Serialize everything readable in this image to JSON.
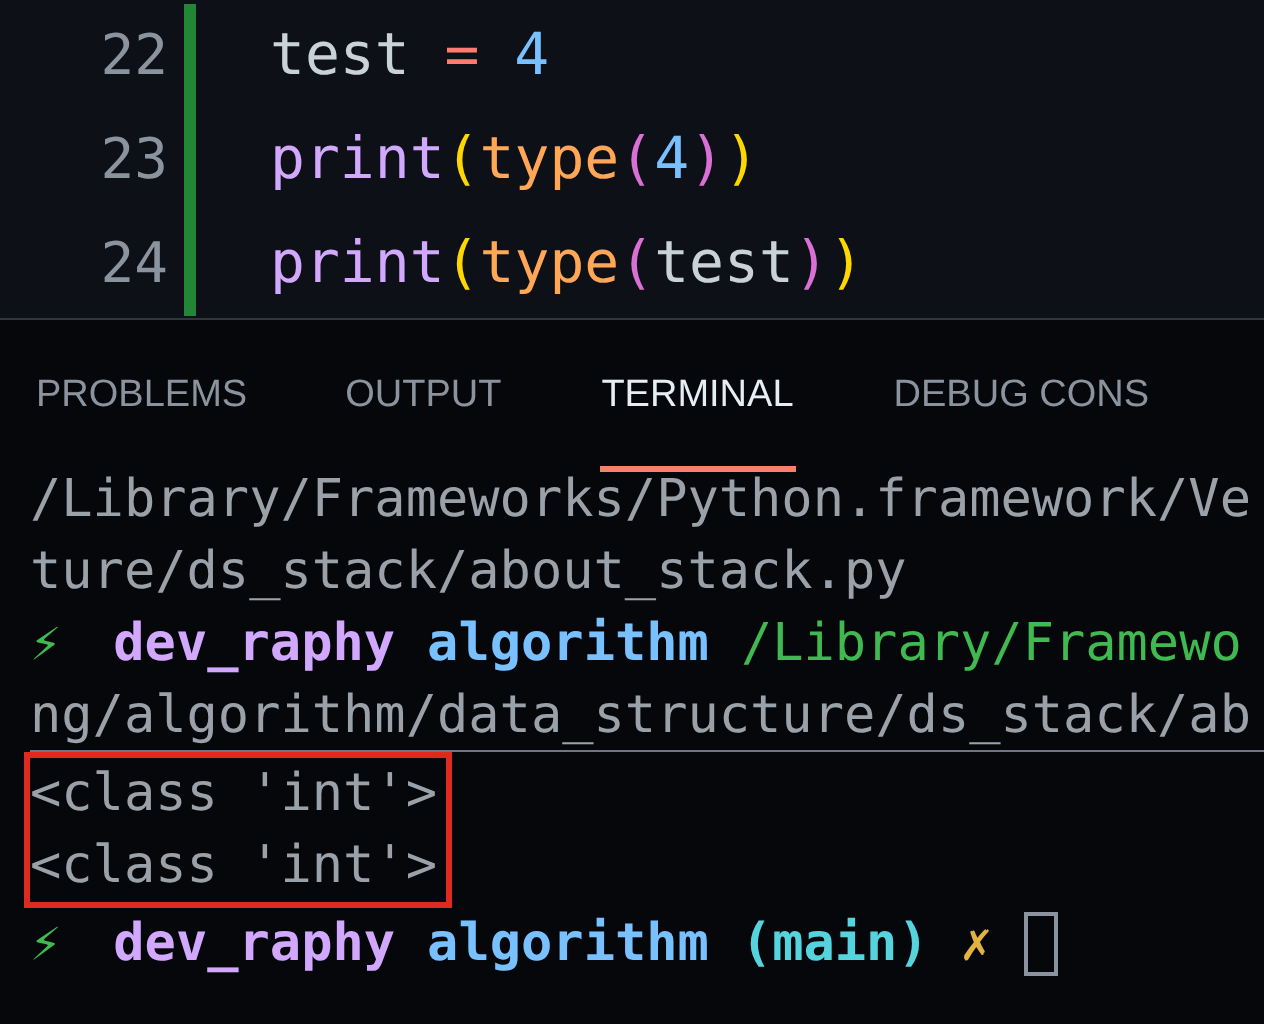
{
  "editor": {
    "lines": [
      {
        "number": "22",
        "tokens": [
          {
            "kind": "plain",
            "text": "test"
          },
          {
            "kind": "space"
          },
          {
            "kind": "op",
            "text": "="
          },
          {
            "kind": "space"
          },
          {
            "kind": "num",
            "text": "4"
          }
        ]
      },
      {
        "number": "23",
        "tokens": [
          {
            "kind": "builtin",
            "text": "print"
          },
          {
            "kind": "paren1",
            "text": "("
          },
          {
            "kind": "func",
            "text": "type"
          },
          {
            "kind": "paren2",
            "text": "("
          },
          {
            "kind": "num",
            "text": "4"
          },
          {
            "kind": "paren2",
            "text": ")"
          },
          {
            "kind": "paren1",
            "text": ")"
          }
        ]
      },
      {
        "number": "24",
        "tokens": [
          {
            "kind": "builtin",
            "text": "print"
          },
          {
            "kind": "paren1",
            "text": "("
          },
          {
            "kind": "func",
            "text": "type"
          },
          {
            "kind": "paren2",
            "text": "("
          },
          {
            "kind": "plain",
            "text": "test"
          },
          {
            "kind": "paren2",
            "text": ")"
          },
          {
            "kind": "paren1",
            "text": ")"
          }
        ]
      }
    ]
  },
  "tabs": [
    {
      "label": "PROBLEMS",
      "selected": false
    },
    {
      "label": "OUTPUT",
      "selected": false
    },
    {
      "label": "TERMINAL",
      "selected": true
    },
    {
      "label": "DEBUG CONS",
      "selected": false
    }
  ],
  "terminal": {
    "blocks": [
      {
        "highlighted": false,
        "lines": [
          [
            {
              "kind": "text",
              "text": "/Library/Frameworks/Python.framework/Ve"
            }
          ],
          [
            {
              "kind": "text",
              "text": "ture/ds_stack/about_stack.py"
            }
          ],
          [
            {
              "kind": "bolt",
              "text": "⚡"
            },
            {
              "kind": "user",
              "text": "dev_raphy"
            },
            {
              "kind": "dir",
              "text": "algorithm"
            },
            {
              "kind": "path",
              "text": "/Library/Framewo"
            }
          ],
          [
            {
              "kind": "text",
              "text": "ng/algorithm/data_structure/ds_stack/ab"
            }
          ]
        ]
      },
      {
        "highlighted": true,
        "lines": [
          [
            {
              "kind": "text",
              "text": "<class 'int'>"
            }
          ],
          [
            {
              "kind": "text",
              "text": "<class 'int'>"
            }
          ]
        ]
      },
      {
        "highlighted": false,
        "lines": [
          [
            {
              "kind": "bolt",
              "text": "⚡"
            },
            {
              "kind": "user",
              "text": "dev_raphy"
            },
            {
              "kind": "dir",
              "text": "algorithm"
            },
            {
              "kind": "branch",
              "text": "(main)"
            },
            {
              "kind": "dirty",
              "text": "✗"
            },
            {
              "kind": "cursor"
            }
          ]
        ]
      }
    ]
  }
}
